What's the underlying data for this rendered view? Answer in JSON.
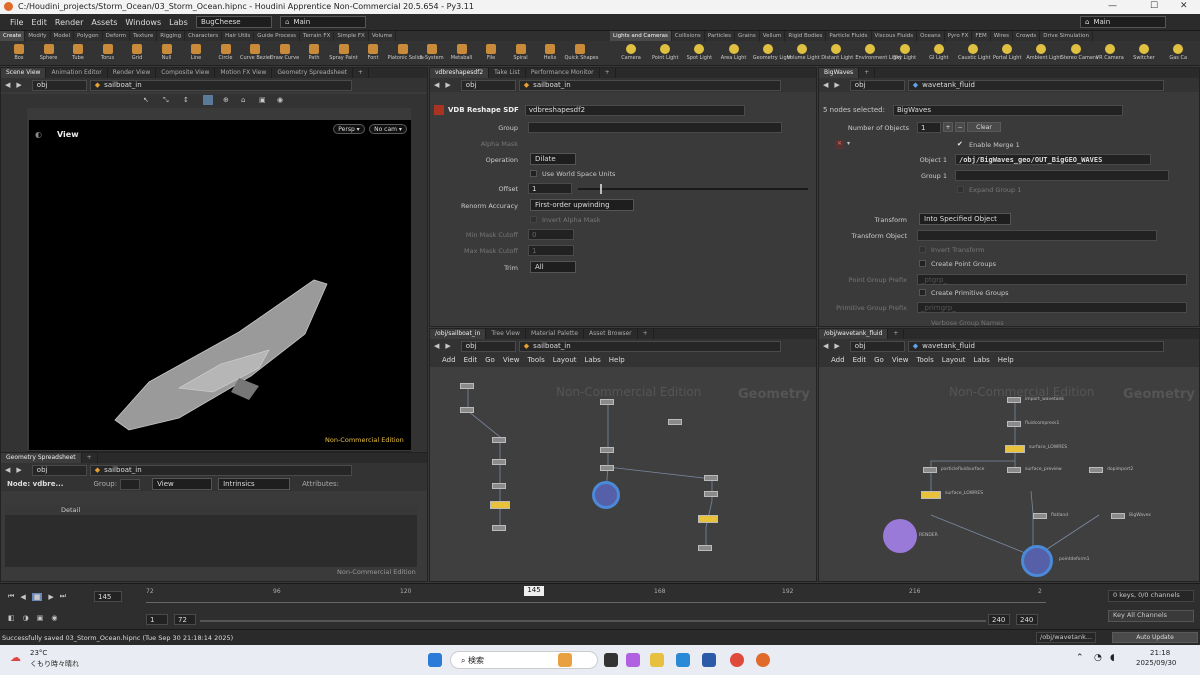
{
  "window": {
    "title": "C:/Houdini_projects/Storm_Ocean/03_Storm_Ocean.hipnc - Houdini Apprentice Non-Commercial 20.5.654 - Py3.11",
    "min": "—",
    "max": "☐",
    "close": "✕"
  },
  "menu": {
    "items": [
      "File",
      "Edit",
      "Render",
      "Assets",
      "Windows",
      "Labs",
      "Help"
    ],
    "desktop": "BugCheese",
    "main": "Main",
    "main_right": "Main"
  },
  "shelf_tabs_left": [
    "Create",
    "Modify",
    "Model",
    "Polygon",
    "Deform",
    "Texture",
    "Rigging",
    "Characters",
    "Hair Utils",
    "Guide Process",
    "Terrain FX",
    "Simple FX",
    "Volume"
  ],
  "shelf_tabs_right": [
    "Lights and Cameras",
    "Collisions",
    "Particles",
    "Grains",
    "Vellum",
    "Rigid Bodies",
    "Particle Fluids",
    "Viscous Fluids",
    "Oceans",
    "Pyro FX",
    "FEM",
    "Wires",
    "Crowds",
    "Drive Simulation"
  ],
  "tools_left": [
    "Box",
    "Sphere",
    "Tube",
    "Torus",
    "Grid",
    "Null",
    "Line",
    "Circle",
    "Curve Bezier",
    "Draw Curve",
    "Path",
    "Spray Paint",
    "Font",
    "Platonic Solids",
    "L-System",
    "Metaball",
    "File",
    "Spiral",
    "Helix",
    "Quick Shapes"
  ],
  "tools_right": [
    "Camera",
    "Point Light",
    "Spot Light",
    "Area Light",
    "Geometry Light",
    "Volume Light",
    "Distant Light",
    "Environment Light",
    "Sky Light",
    "GI Light",
    "Caustic Light",
    "Portal Light",
    "Ambient Light",
    "Stereo Camera",
    "VR Camera",
    "Switcher",
    "Gas Ca"
  ],
  "colors": {
    "shelf_icon": "#c98a3a",
    "light_icon": "#e0c040",
    "accent_blue": "#5fa3e8",
    "node_yellow": "#e8c23a",
    "node_purple": "#9a7ad8"
  },
  "viewport": {
    "tabs": [
      "Scene View",
      "Animation Editor",
      "Render View",
      "Composite View",
      "Motion FX View",
      "Geometry Spreadsheet"
    ],
    "path_root": "obj",
    "path_node": "sailboat_in",
    "label": "View",
    "persp": "Persp ▾",
    "cam": "No cam ▾",
    "watermark": "Non-Commercial Edition"
  },
  "params": {
    "tabs": [
      "vdbreshapesdf2",
      "Take List",
      "Performance Monitor"
    ],
    "path_root": "obj",
    "path_node": "sailboat_in",
    "node_type": "VDB Reshape SDF",
    "node_name": "vdbreshapesdf2",
    "group": "Group",
    "alpha_mask": "Alpha Mask",
    "operation": "Operation",
    "operation_val": "Dilate",
    "world_units": "Use World Space Units",
    "offset": "Offset",
    "offset_val": "1",
    "renorm": "Renorm Accuracy",
    "renorm_val": "First-order upwinding",
    "invert_alpha": "Invert Alpha Mask",
    "min_mask": "Min Mask Cutoff",
    "min_mask_val": "0",
    "max_mask": "Max Mask Cutoff",
    "max_mask_val": "1",
    "trim": "Trim",
    "trim_val": "All"
  },
  "merge": {
    "tab": "BigWaves",
    "path_root": "obj",
    "path_node": "wavetank_fluid",
    "selected": "5 nodes selected:",
    "selected_val": "BigWaves",
    "num_objects": "Number of Objects",
    "num_val": "1",
    "clear": "Clear",
    "enable": "Enable Merge 1",
    "object1": "Object 1",
    "object1_val": "/obj/BigWaves_geo/OUT_BigGEO_WAVES",
    "group1": "Group 1",
    "expand": "Expand Group 1",
    "transform": "Transform",
    "transform_val": "Into Specified Object",
    "transform_obj": "Transform Object",
    "invert": "Invert Transform",
    "pt_groups": "Create Point Groups",
    "pt_prefix": "Point Group Prefix",
    "pt_prefix_val": "_ptgrp_",
    "prim_groups": "Create Primitive Groups",
    "prim_prefix": "Primitive Group Prefix",
    "prim_prefix_val": "_primgrp_",
    "verbose": "Verbose Group Names"
  },
  "net_left": {
    "tabs": [
      "/obj/sailboat_in",
      "Tree View",
      "Material Palette",
      "Asset Browser"
    ],
    "path_root": "obj",
    "path_node": "sailboat_in",
    "menu": [
      "Add",
      "Edit",
      "Go",
      "View",
      "Tools",
      "Layout",
      "Labs",
      "Help"
    ],
    "wm1": "Non-Commercial Edition",
    "wm2": "Geometry"
  },
  "net_right": {
    "tabs": [
      "/obj/wavetank_fluid"
    ],
    "path_root": "obj",
    "path_node": "wavetank_fluid",
    "menu": [
      "Add",
      "Edit",
      "Go",
      "View",
      "Tools",
      "Layout",
      "Labs",
      "Help"
    ],
    "wm1": "Non-Commercial Edition",
    "wm2": "Geometry",
    "nodes": [
      "import_wavetank",
      "fluidcompress1",
      "surface_LOWRES",
      "particlefluidsurface",
      "surface_preview",
      "dopimport2",
      "surface_LOWRES",
      "flatland",
      "BigWaves",
      "RENDER",
      "pointdeform1"
    ]
  },
  "spreadsheet": {
    "tab": "Geometry Spreadsheet",
    "path_root": "obj",
    "path_node": "sailboat_in",
    "node": "Node: vdbre...",
    "group": "Group:",
    "view": "View",
    "intrinsics": "Intrinsics",
    "attributes": "Attributes:",
    "col_detail": "Detail",
    "watermark": "Non-Commercial Edition"
  },
  "timeline": {
    "frame": "145",
    "ticks": [
      "72",
      "96",
      "120",
      "168",
      "192",
      "216",
      "2"
    ],
    "current": "145",
    "start": "1",
    "start2": "72",
    "end": "240",
    "end2": "240",
    "keys": "0 keys, 0/0 channels",
    "key_all": "Key All Channels",
    "auto": "Auto Update",
    "path": "/obj/wavetank..."
  },
  "status": "Successfully saved 03_Storm_Ocean.hipnc (Tue Sep 30 21:18:14 2025)",
  "taskbar": {
    "temp": "23°C",
    "weather": "くもり時々晴れ",
    "search": "検索",
    "time": "21:18",
    "date": "2025/09/30"
  }
}
